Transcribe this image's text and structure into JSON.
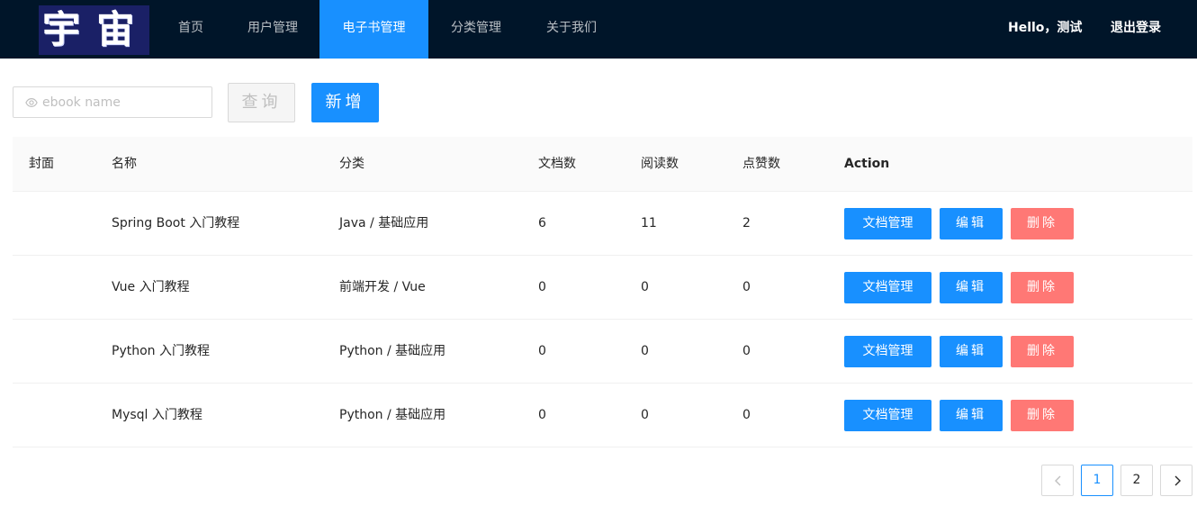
{
  "header": {
    "logo_text": [
      "宇",
      "宙"
    ],
    "nav": [
      {
        "label": "首页",
        "active": false
      },
      {
        "label": "用户管理",
        "active": false
      },
      {
        "label": "电子书管理",
        "active": true
      },
      {
        "label": "分类管理",
        "active": false
      },
      {
        "label": "关于我们",
        "active": false
      }
    ],
    "greeting": "Hello，测试",
    "logout": "退出登录"
  },
  "toolbar": {
    "search_placeholder": "ebook name",
    "search_value": "",
    "query_label": "查询",
    "add_label": "新增"
  },
  "table": {
    "columns": [
      "封面",
      "名称",
      "分类",
      "文档数",
      "阅读数",
      "点赞数",
      "Action"
    ],
    "rows": [
      {
        "cover": "",
        "name": "Spring Boot 入门教程",
        "category": "Java / 基础应用",
        "docs": "6",
        "views": "11",
        "likes": "2"
      },
      {
        "cover": "",
        "name": "Vue 入门教程",
        "category": "前端开发 / Vue",
        "docs": "0",
        "views": "0",
        "likes": "0"
      },
      {
        "cover": "",
        "name": "Python 入门教程",
        "category": "Python / 基础应用",
        "docs": "0",
        "views": "0",
        "likes": "0"
      },
      {
        "cover": "",
        "name": "Mysql 入门教程",
        "category": "Python / 基础应用",
        "docs": "0",
        "views": "0",
        "likes": "0"
      }
    ],
    "actions": {
      "doc_label": "文档管理",
      "edit_label": "编辑",
      "delete_label": "删除"
    }
  },
  "pagination": {
    "pages": [
      "1",
      "2"
    ],
    "current": "1"
  },
  "colors": {
    "header_bg": "#001529",
    "primary": "#1890ff",
    "danger": "#ff7875",
    "border": "#d9d9d9"
  }
}
